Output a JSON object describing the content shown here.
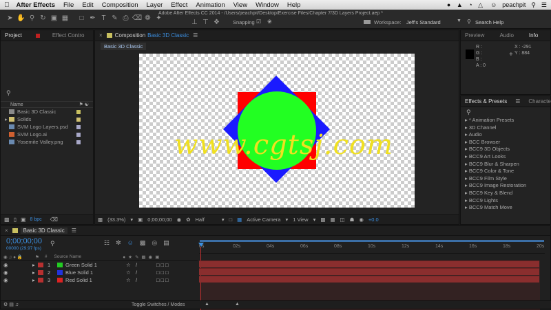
{
  "menubar": {
    "app": "After Effects",
    "items": [
      "File",
      "Edit",
      "Composition",
      "Layer",
      "Effect",
      "Animation",
      "View",
      "Window",
      "Help"
    ],
    "user": "peachpit"
  },
  "toolbar": {
    "window_title": "Adobe After Effects CC 2014 - /Users/peachpit/Desktop/Exercise Files/Chapter 7/3D Layers Project.aep *",
    "snapping_label": "Snapping",
    "workspace_label": "Workspace:",
    "workspace_value": "Jeff's Standard",
    "search_placeholder": "Search Help"
  },
  "project_panel": {
    "tabs": [
      "Project",
      "Effect Contro"
    ],
    "col_name": "Name",
    "items": [
      {
        "name": "Basic 3D Classic",
        "icon": "composition-icon",
        "color": "#c8c060"
      },
      {
        "name": "Solids",
        "icon": "folder-icon",
        "color": "#d0c070"
      },
      {
        "name": "SVM Logo Layers.psd",
        "icon": "psd-file-icon",
        "color": "#a8a8c8"
      },
      {
        "name": "SVM Logo.ai",
        "icon": "ai-file-icon",
        "color": "#a8a8c8"
      },
      {
        "name": "Yosemite Valley.png",
        "icon": "png-file-icon",
        "color": "#a8a8c8"
      }
    ],
    "bpc": "8 bpc"
  },
  "comp_panel": {
    "tab_prefix": "Composition",
    "tab_name": "Basic 3D Classic",
    "subtab": "Basic 3D Classic",
    "zoom": "(33.3%)",
    "timecode": "0;00;00;00",
    "resolution": "Half",
    "camera": "Active Camera",
    "views": "1 View",
    "exposure": "+0.0"
  },
  "watermark": "www.cgtsj.com",
  "info_panel": {
    "tabs": [
      "Preview",
      "Audio",
      "Info"
    ],
    "r": "R :",
    "g": "G :",
    "b": "B :",
    "a": "A : 0",
    "x": "X : -291",
    "y": "Y : 884"
  },
  "effects_panel": {
    "tabs": [
      "Effects & Presets",
      "Character"
    ],
    "items": [
      "* Animation Presets",
      "3D Channel",
      "Audio",
      "BCC Browser",
      "BCC9 3D Objects",
      "BCC9 Art Looks",
      "BCC9 Blur & Sharpen",
      "BCC9 Color & Tone",
      "BCC9 Film Style",
      "BCC9 Image Restoration",
      "BCC9 Key & Blend",
      "BCC9 Lights",
      "BCC9 Match Move"
    ]
  },
  "timeline": {
    "tab_name": "Basic 3D Classic",
    "timecode": "0;00;00;00",
    "fps": "00000 (29.97 fps)",
    "col_source": "Source Name",
    "ruler": [
      "0s",
      "02s",
      "04s",
      "06s",
      "08s",
      "10s",
      "12s",
      "14s",
      "16s",
      "18s",
      "20s"
    ],
    "layers": [
      {
        "num": "1",
        "name": "Green Solid 1",
        "color": "#22cc22"
      },
      {
        "num": "2",
        "name": "Blue Solid 1",
        "color": "#2233dd"
      },
      {
        "num": "3",
        "name": "Red Solid 1",
        "color": "#dd2222"
      }
    ],
    "toggle_label": "Toggle Switches / Modes"
  },
  "colors": {
    "accent": "#3c8fe0",
    "red_solid": "#ff0000",
    "blue_solid": "#1a1aff",
    "green_solid": "#22ff22",
    "watermark": "#f0e020",
    "track": "#8a2f2f"
  }
}
